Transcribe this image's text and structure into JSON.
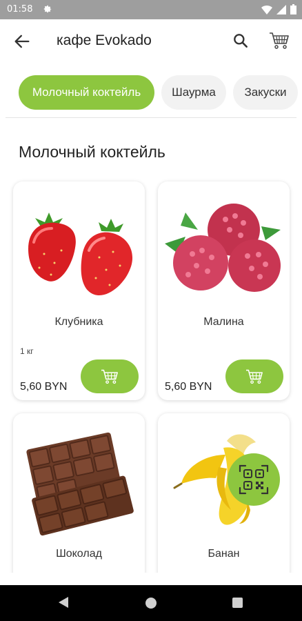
{
  "status_bar": {
    "time": "01:58",
    "icons": [
      "gear-icon",
      "wifi-icon",
      "signal-icon",
      "battery-icon"
    ]
  },
  "app_bar": {
    "title": "кафе Evokado",
    "icons": [
      "back-arrow-icon",
      "search-icon",
      "cart-icon"
    ]
  },
  "tabs": [
    {
      "label": "Молочный коктейль",
      "active": true
    },
    {
      "label": "Шаурма",
      "active": false
    },
    {
      "label": "Закуски",
      "active": false
    }
  ],
  "section": {
    "title": "Молочный коктейль"
  },
  "products": [
    {
      "name": "Клубника",
      "weight": "1 кг",
      "price": "5,60 BYN",
      "image": "strawberries"
    },
    {
      "name": "Малина",
      "weight": "",
      "price": "5,60 BYN",
      "image": "raspberries"
    },
    {
      "name": "Шоколад",
      "image": "chocolate-bar"
    },
    {
      "name": "Банан",
      "image": "banana"
    }
  ],
  "colors": {
    "accent": "#8dc63f",
    "status_bar": "#9e9e9e",
    "nav_bar": "#000000"
  }
}
